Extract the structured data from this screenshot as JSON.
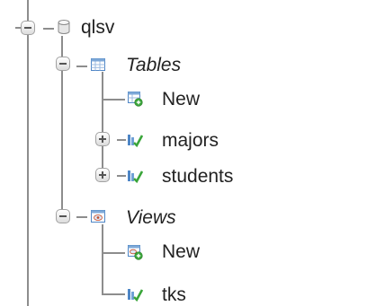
{
  "tree": {
    "database": {
      "label": "qlsv",
      "icon": "database-icon",
      "expanded": true,
      "children": {
        "tables": {
          "label": "Tables",
          "icon": "table-group-icon",
          "expanded": true,
          "items": [
            {
              "label": "New",
              "icon": "new-table-icon"
            },
            {
              "label": "majors",
              "icon": "table-icon",
              "expandable": true
            },
            {
              "label": "students",
              "icon": "table-icon",
              "expandable": true
            }
          ]
        },
        "views": {
          "label": "Views",
          "icon": "view-group-icon",
          "expanded": true,
          "items": [
            {
              "label": "New",
              "icon": "new-view-icon"
            },
            {
              "label": "tks",
              "icon": "view-icon"
            }
          ]
        }
      }
    }
  },
  "colors": {
    "connector": "#8d8d8d",
    "table_icon_blue": "#4f86c6",
    "add_badge_green": "#3aa53a"
  }
}
